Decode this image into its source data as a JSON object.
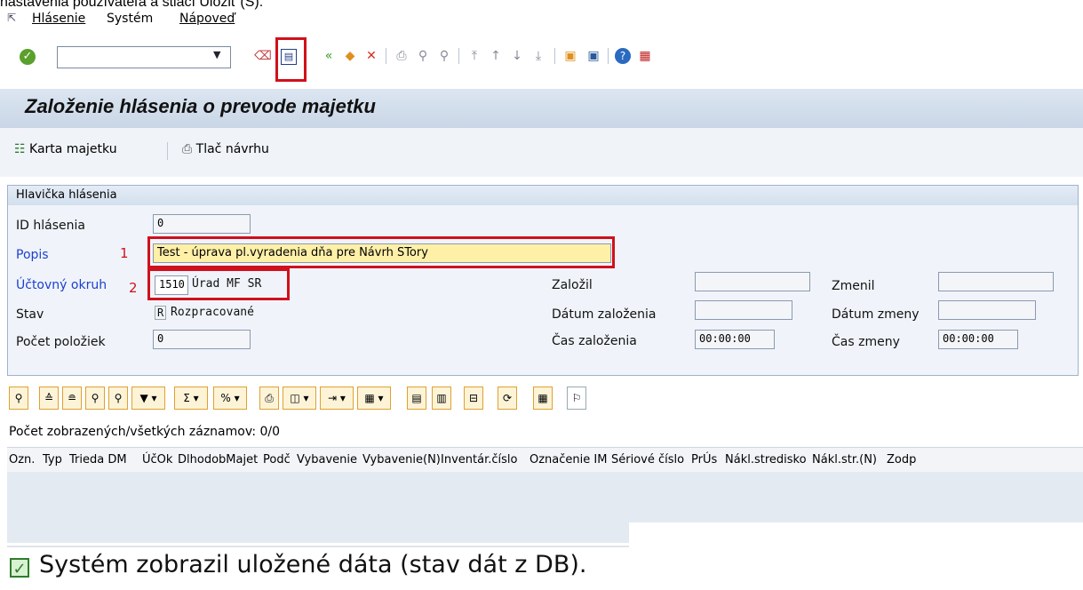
{
  "top_cut_text": "nastavenia používateľa a stlačí Uložiť (S).",
  "menu": {
    "hlasenie": "Hlásenie",
    "system": "Systém",
    "napoved": "Nápoveď"
  },
  "title": "Založenie hlásenia o prevode majetku",
  "app_toolbar": {
    "karta": "Karta majetku",
    "tlac": "Tlač návrhu"
  },
  "group": {
    "title": "Hlavička hlásenia"
  },
  "fields": {
    "id_label": "ID hlásenia",
    "id_value": "0",
    "popis_label": "Popis",
    "popis_value": "Test - úprava pl.vyradenia dňa pre Návrh STory",
    "okruh_label": "Účtovný okruh",
    "okruh_value": "1510",
    "okruh_text": "Úrad MF SR",
    "stav_label": "Stav",
    "stav_code": "R",
    "stav_text": "Rozpracované",
    "pocet_label": "Počet položiek",
    "pocet_value": "0",
    "zalozil_label": "Založil",
    "zalozil_value": "",
    "datum_zal_label": "Dátum založenia",
    "datum_zal_value": "",
    "cas_zal_label": "Čas založenia",
    "cas_zal_value": "00:00:00",
    "zmenil_label": "Zmenil",
    "zmenil_value": "",
    "datum_zm_label": "Dátum zmeny",
    "datum_zm_value": "",
    "cas_zm_label": "Čas zmeny",
    "cas_zm_value": "00:00:00"
  },
  "annotations": {
    "n1": "1",
    "n2": "2"
  },
  "grid": {
    "count_text": "Počet zobrazených/všetkých záznamov: 0/0",
    "columns": [
      "Ozn.",
      "Typ",
      "Trieda DM",
      "ÚčOk",
      "DlhodobMajet",
      "Podč",
      "Vybavenie",
      "Vybavenie(N)",
      "Inventár.číslo",
      "Označenie IM",
      "Sériové číslo",
      "PrÚs",
      "Nákl.stredisko",
      "Nákl.str.(N)",
      "Zodp"
    ]
  },
  "status": {
    "message": "Systém zobrazil uložené dáta (stav dát z DB)."
  },
  "colors": {
    "highlight": "#d0101c",
    "label_blue": "#1c3fcf",
    "field_yellow": "#fff0a8"
  }
}
